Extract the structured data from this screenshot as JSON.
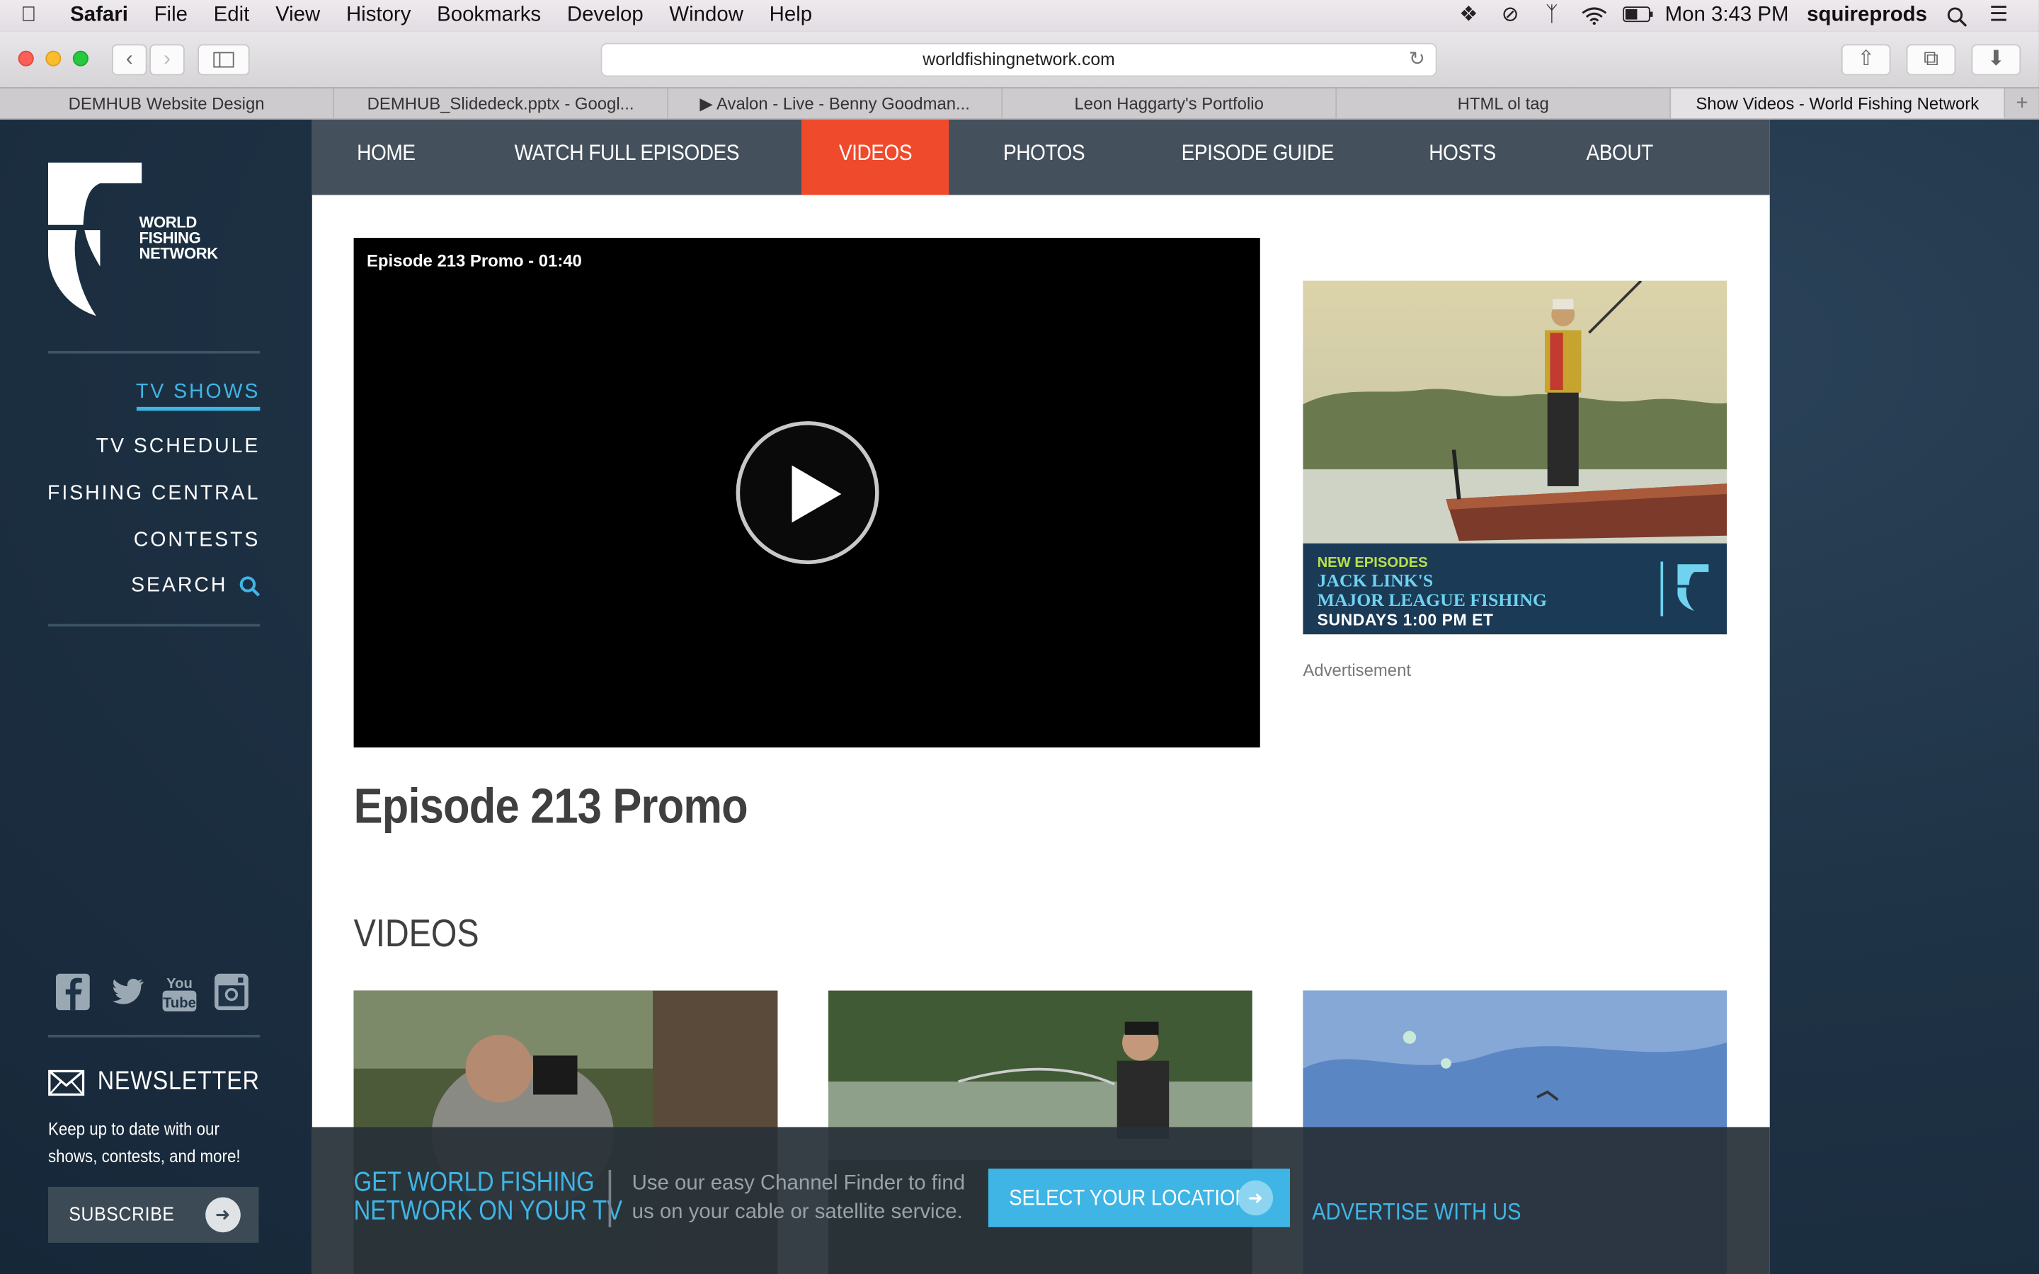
{
  "menubar": {
    "app": "Safari",
    "items": [
      "File",
      "Edit",
      "View",
      "History",
      "Bookmarks",
      "Develop",
      "Window",
      "Help"
    ],
    "clock": "Mon 3:43 PM",
    "user": "squireprods"
  },
  "toolbar": {
    "url": "worldfishingnetwork.com"
  },
  "tabs": [
    {
      "label": "DEMHUB Website Design"
    },
    {
      "label": "DEMHUB_Slidedeck.pptx - Googl..."
    },
    {
      "label": "▶ Avalon - Live - Benny Goodman..."
    },
    {
      "label": "Leon Haggarty's Portfolio"
    },
    {
      "label": "HTML ol tag"
    },
    {
      "label": "Show Videos - World Fishing Network"
    }
  ],
  "logo": {
    "line1": "WORLD",
    "line2": "FISHING",
    "line3": "NETWORK"
  },
  "sidebar": {
    "items": [
      {
        "label": "TV SHOWS"
      },
      {
        "label": "TV SCHEDULE"
      },
      {
        "label": "FISHING CENTRAL"
      },
      {
        "label": "CONTESTS"
      },
      {
        "label": "SEARCH"
      }
    ],
    "newsletter_title": "NEWSLETTER",
    "newsletter_text": "Keep up to date with our shows, contests, and more!",
    "subscribe_label": "SUBSCRIBE"
  },
  "topnav": {
    "items": [
      {
        "label": "HOME"
      },
      {
        "label": "WATCH FULL EPISODES"
      },
      {
        "label": "VIDEOS"
      },
      {
        "label": "PHOTOS"
      },
      {
        "label": "EPISODE GUIDE"
      },
      {
        "label": "HOSTS"
      },
      {
        "label": "ABOUT"
      }
    ],
    "active": "VIDEOS"
  },
  "player": {
    "overlay_title": "Episode 213 Promo - 01:40"
  },
  "main": {
    "title": "Episode 213 Promo",
    "videos_heading": "VIDEOS"
  },
  "ad": {
    "new_label": "NEW EPISODES",
    "line1": "JACK LINK'S",
    "line2": "MAJOR LEAGUE FISHING",
    "line3": "SUNDAYS 1:00 PM ET",
    "caption": "Advertisement"
  },
  "bottom_bar": {
    "title_line1": "GET WORLD FISHING",
    "title_line2": "NETWORK ON YOUR TV",
    "text": "Use our easy Channel Finder to find us on your cable or satellite service.",
    "button_label": "SELECT YOUR LOCATION",
    "advertise_label": "ADVERTISE WITH US"
  },
  "colors": {
    "accent_blue": "#3fb5e6",
    "active_tab_orange": "#ee4a2b",
    "nav_bg": "#44505c"
  }
}
